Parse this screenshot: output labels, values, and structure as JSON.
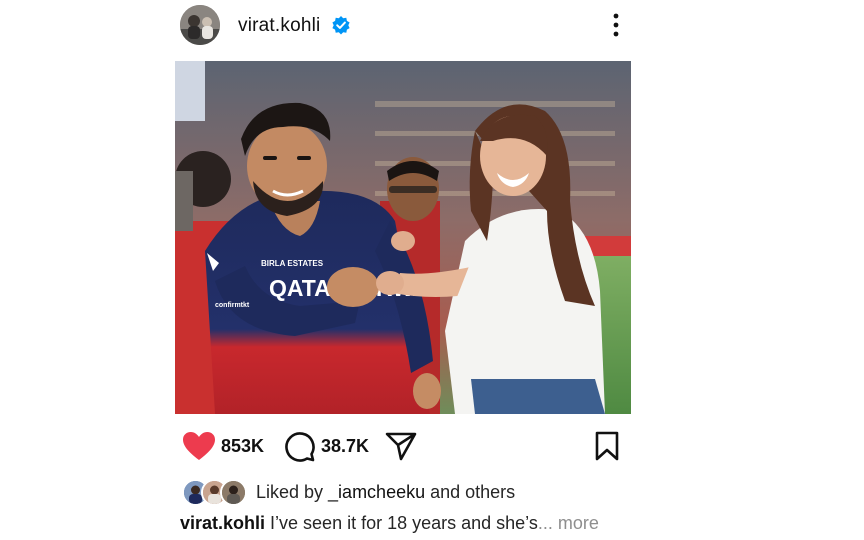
{
  "post": {
    "username": "virat.kohli",
    "verified": true,
    "photo_alt": "Virat Kohli and Anushka Sharma on the cricket field",
    "jersey_sponsor": "QATAR AIRWAYS",
    "jersey_logo_left": "BIRLA ESTATES",
    "jersey_logo_small": "confirmtkt"
  },
  "actions": {
    "likes": "853K",
    "comments": "38.7K"
  },
  "liked_by": {
    "prefix": "Liked by ",
    "user": "_iamcheeku",
    "suffix": " and others"
  },
  "caption": {
    "user": "virat.kohli",
    "text": " I’ve seen it for 18 years and she’s",
    "more": "... more"
  },
  "colors": {
    "like_red": "#ed3b4e",
    "verified_blue": "#0095f6",
    "jersey_navy": "#1e2a5c",
    "jersey_red": "#d42a2f"
  }
}
